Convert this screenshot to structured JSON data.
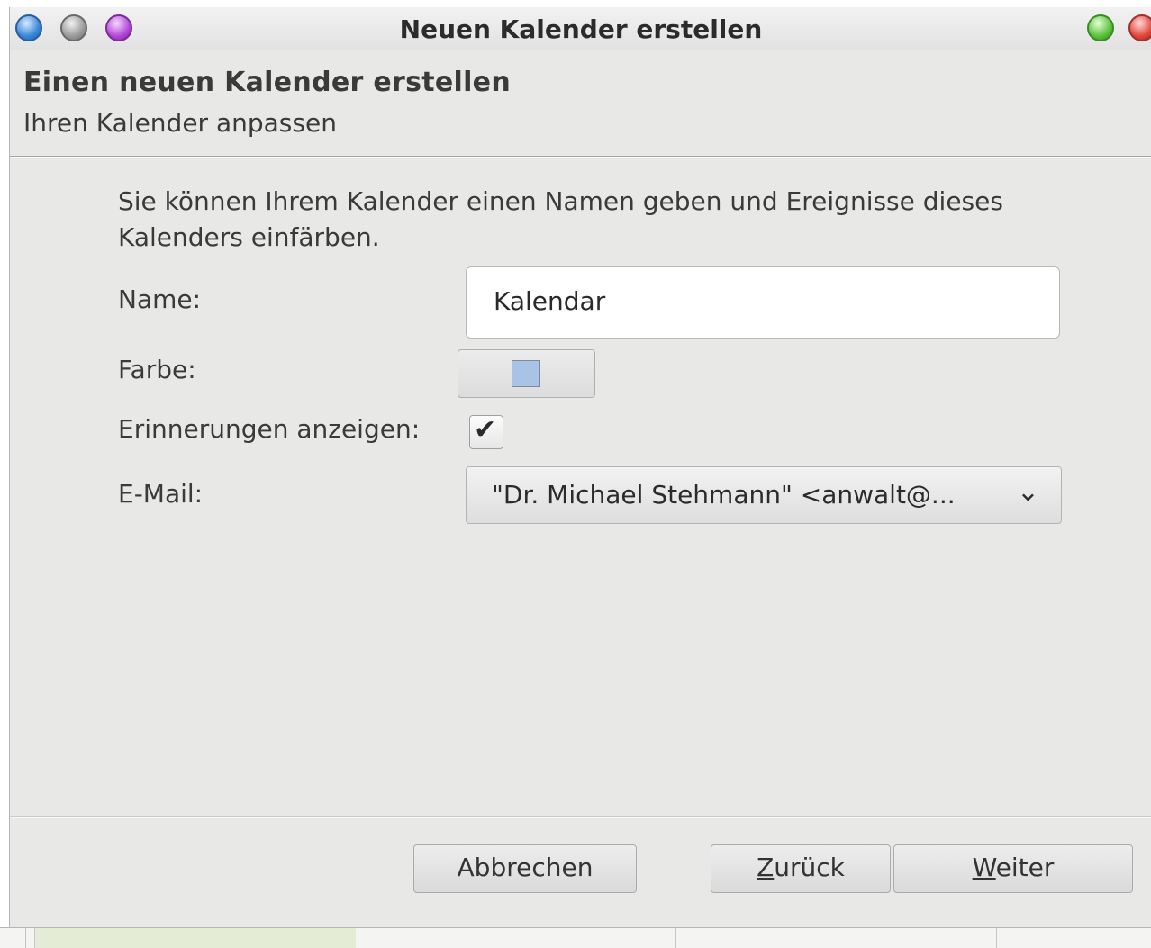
{
  "window": {
    "title": "Neuen Kalender erstellen"
  },
  "header": {
    "title": "Einen neuen Kalender erstellen",
    "subtitle": "Ihren Kalender anpassen"
  },
  "form": {
    "intro": "Sie können Ihrem Kalender einen Namen geben und Ereignisse dieses Kalenders einfärben.",
    "name_label": "Name:",
    "name_value": "Kalendar",
    "color_label": "Farbe:",
    "color_value": "#a9c3e6",
    "reminders_label": "Erinnerungen anzeigen:",
    "reminders_checked": true,
    "email_label": "E-Mail:",
    "email_value": "\"Dr. Michael Stehmann\" <anwalt@..."
  },
  "buttons": {
    "cancel": "Abbrechen",
    "back_mnemonic": "Z",
    "back_rest": "urück",
    "next_mnemonic": "W",
    "next_rest": "eiter"
  }
}
